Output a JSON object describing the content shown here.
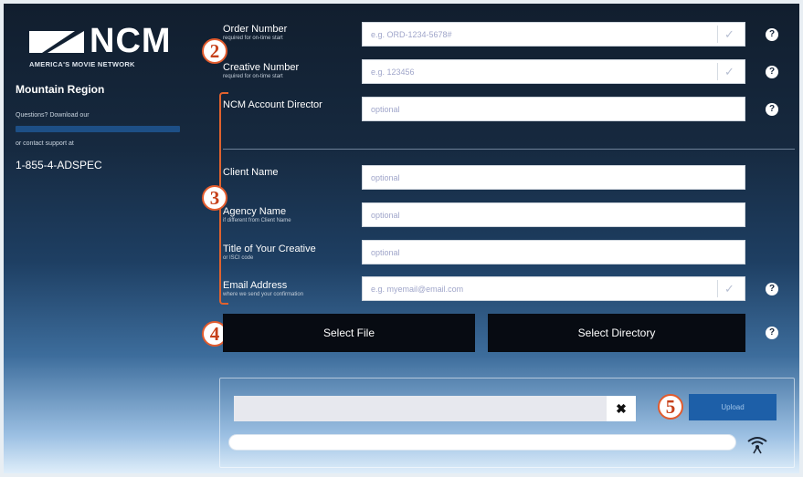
{
  "brand": {
    "logo_text": "NCM",
    "tagline": "AMERICA'S MOVIE NETWORK"
  },
  "sidebar": {
    "region": "Mountain Region",
    "questions_text": "Questions? Download our",
    "contact_text": "or contact support at",
    "phone": "1-855-4-ADSPEC"
  },
  "form": {
    "order_number": {
      "label": "Order Number",
      "sub": "required for on-time start",
      "placeholder": "e.g. ORD-1234-5678#"
    },
    "creative_number": {
      "label": "Creative Number",
      "sub": "required for on-time start",
      "placeholder": "e.g. 123456"
    },
    "account_director": {
      "label": "NCM Account Director",
      "placeholder": "optional"
    },
    "client_name": {
      "label": "Client Name",
      "placeholder": "optional"
    },
    "agency_name": {
      "label": "Agency Name",
      "sub": "if different from Client Name",
      "placeholder": "optional"
    },
    "creative_title": {
      "label": "Title of Your Creative",
      "sub": "or ISCI code",
      "placeholder": "optional"
    },
    "email": {
      "label": "Email Address",
      "sub": "where we send your confirmation",
      "placeholder": "e.g. myemail@email.com"
    }
  },
  "buttons": {
    "select_file": "Select File",
    "select_directory": "Select Directory",
    "upload": "Upload",
    "clear": "✖"
  },
  "annotations": [
    "2",
    "3",
    "4",
    "5"
  ],
  "upload_progress": 0,
  "icons": {
    "help": "help-icon",
    "check": "checkmark-icon",
    "clear": "close-icon",
    "connection": "wifi-icon"
  },
  "colors": {
    "accent_blue": "#1d5fa8",
    "annotation_red": "#e25b2d"
  }
}
